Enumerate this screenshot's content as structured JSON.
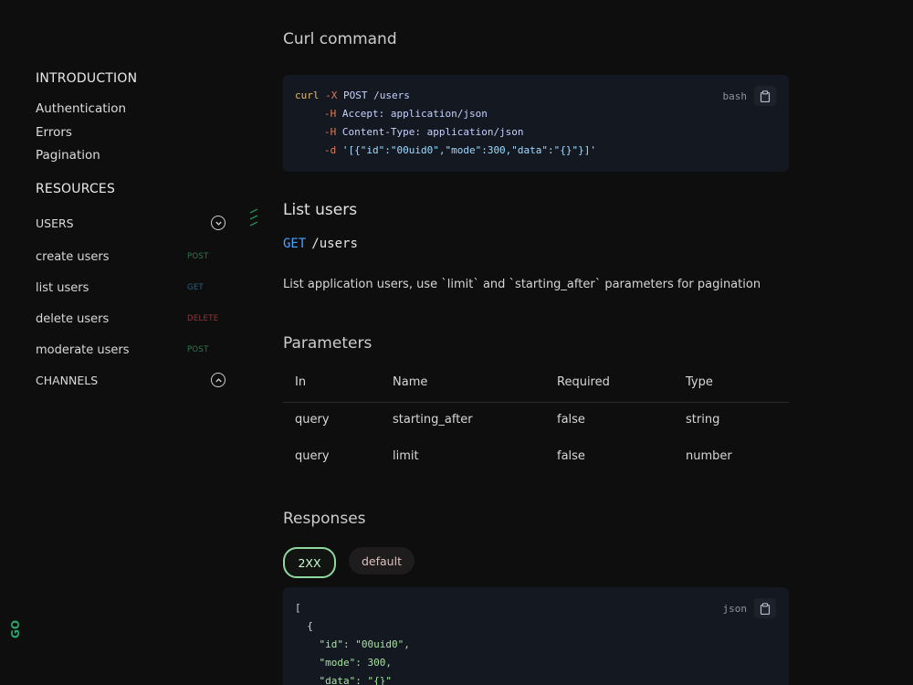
{
  "sidebar": {
    "introduction_title": "INTRODUCTION",
    "intro_links": [
      "Authentication",
      "Errors",
      "Pagination"
    ],
    "resources_title": "RESOURCES",
    "users_group": {
      "label": "USERS",
      "state": "expanded",
      "endpoints": [
        {
          "label": "create users",
          "method": "POST"
        },
        {
          "label": "list users",
          "method": "GET"
        },
        {
          "label": "delete users",
          "method": "DELETE"
        },
        {
          "label": "moderate users",
          "method": "POST"
        }
      ]
    },
    "channels_group": {
      "label": "CHANNELS",
      "state": "collapsed"
    },
    "brand_mark": "GO"
  },
  "curl_section": {
    "title": "Curl command",
    "lang": "bash",
    "lines": [
      {
        "cmd": "curl",
        "flag": "-X",
        "rest": "POST /users"
      },
      {
        "flag": "-H",
        "rest": "Accept: application/json"
      },
      {
        "flag": "-H",
        "rest": "Content-Type: application/json"
      },
      {
        "flag": "-d",
        "rest": "'[{\"id\":\"00uid0\",\"mode\":300,\"data\":\"{}\"}]'"
      }
    ]
  },
  "endpoint": {
    "title": "List users",
    "method": "GET",
    "path": "/users",
    "description": "List application users, use `limit` and `starting_after` parameters for pagination"
  },
  "parameters": {
    "title": "Parameters",
    "headers": [
      "In",
      "Name",
      "Required",
      "Type"
    ],
    "rows": [
      [
        "query",
        "starting_after",
        "false",
        "string"
      ],
      [
        "query",
        "limit",
        "false",
        "number"
      ]
    ]
  },
  "responses": {
    "title": "Responses",
    "tabs": [
      "2XX",
      "default"
    ],
    "active_tab": "2XX",
    "lang": "json",
    "lines": [
      "[",
      "  {",
      "    \"id\": \"00uid0\",",
      "    \"mode\": 300,",
      "    \"data\": \"{}\""
    ]
  },
  "colors": {
    "background": "#0f0e0e",
    "code_bg": "#141820",
    "get": "#4aa3ff",
    "active_pill": "#8fd6a0"
  }
}
